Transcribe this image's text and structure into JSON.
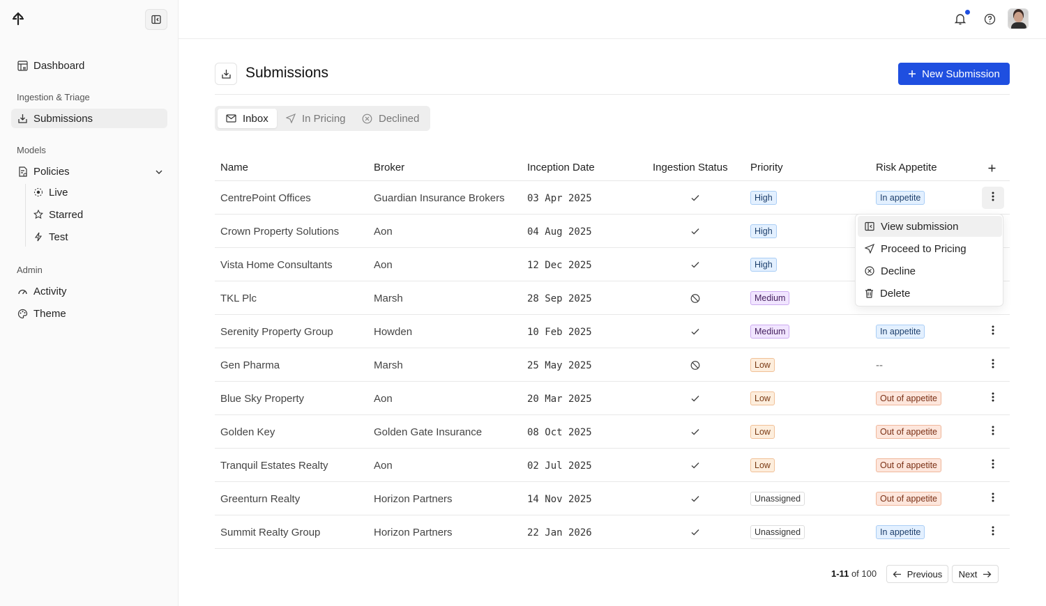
{
  "sidebar": {
    "logo": "app-logo",
    "items": [
      {
        "label": "Dashboard",
        "icon": "dashboard-icon"
      },
      {
        "label": "Submissions",
        "icon": "inbox-download-icon"
      },
      {
        "label": "Policies",
        "icon": "policy-document-icon"
      },
      {
        "label": "Activity",
        "icon": "gauge-icon"
      },
      {
        "label": "Theme",
        "icon": "palette-icon"
      }
    ],
    "sections": [
      "Ingestion & Triage",
      "Models",
      "Admin"
    ],
    "policy_subitems": [
      {
        "label": "Live",
        "icon": "live-dot-icon"
      },
      {
        "label": "Starred",
        "icon": "star-icon"
      },
      {
        "label": "Test",
        "icon": "bolt-icon"
      }
    ]
  },
  "header": {
    "title": "Submissions",
    "new_button": "New Submission"
  },
  "tabs": [
    {
      "label": "Inbox",
      "icon": "mail-icon"
    },
    {
      "label": "In Pricing",
      "icon": "send-icon"
    },
    {
      "label": "Declined",
      "icon": "x-circle-icon"
    }
  ],
  "table": {
    "columns": [
      "Name",
      "Broker",
      "Inception Date",
      "Ingestion Status",
      "Priority",
      "Risk Appetite"
    ],
    "rows": [
      {
        "name": "CentrePoint Offices",
        "broker": "Guardian Insurance Brokers",
        "date": "03 Apr 2025",
        "status": "check",
        "priority": "High",
        "appetite": "In appetite"
      },
      {
        "name": "Crown Property Solutions",
        "broker": "Aon",
        "date": "04 Aug 2025",
        "status": "check",
        "priority": "High",
        "appetite": ""
      },
      {
        "name": "Vista Home Consultants",
        "broker": "Aon",
        "date": "12 Dec 2025",
        "status": "check",
        "priority": "High",
        "appetite": ""
      },
      {
        "name": "TKL Plc",
        "broker": "Marsh",
        "date": "28 Sep 2025",
        "status": "blocked",
        "priority": "Medium",
        "appetite": ""
      },
      {
        "name": "Serenity Property Group",
        "broker": "Howden",
        "date": "10 Feb 2025",
        "status": "check",
        "priority": "Medium",
        "appetite": "In appetite"
      },
      {
        "name": "Gen Pharma",
        "broker": "Marsh",
        "date": "25 May 2025",
        "status": "blocked",
        "priority": "Low",
        "appetite": "--"
      },
      {
        "name": "Blue Sky Property",
        "broker": "Aon",
        "date": "20 Mar 2025",
        "status": "check",
        "priority": "Low",
        "appetite": "Out of appetite"
      },
      {
        "name": "Golden Key",
        "broker": "Golden Gate Insurance",
        "date": "08 Oct 2025",
        "status": "check",
        "priority": "Low",
        "appetite": "Out of appetite"
      },
      {
        "name": "Tranquil Estates Realty",
        "broker": "Aon",
        "date": "02 Jul 2025",
        "status": "check",
        "priority": "Low",
        "appetite": "Out of appetite"
      },
      {
        "name": "Greenturn Realty",
        "broker": "Horizon  Partners",
        "date": "14 Nov 2025",
        "status": "check",
        "priority": "Unassigned",
        "appetite": "Out of appetite"
      },
      {
        "name": "Summit Realty Group",
        "broker": "Horizon  Partners",
        "date": "22 Jan 2026",
        "status": "check",
        "priority": "Unassigned",
        "appetite": "In appetite"
      }
    ]
  },
  "row_menu": {
    "items": [
      {
        "label": "View submission",
        "icon": "open-panel-icon"
      },
      {
        "label": "Proceed to Pricing",
        "icon": "send-icon"
      },
      {
        "label": "Decline",
        "icon": "x-circle-icon"
      },
      {
        "label": "Delete",
        "icon": "trash-icon"
      }
    ]
  },
  "pagination": {
    "range": "1-11",
    "of_text": "of 100",
    "previous": "Previous",
    "next": "Next"
  },
  "colors": {
    "accent": "#1f4fe0",
    "notification_dot": "#1e4fe0"
  }
}
